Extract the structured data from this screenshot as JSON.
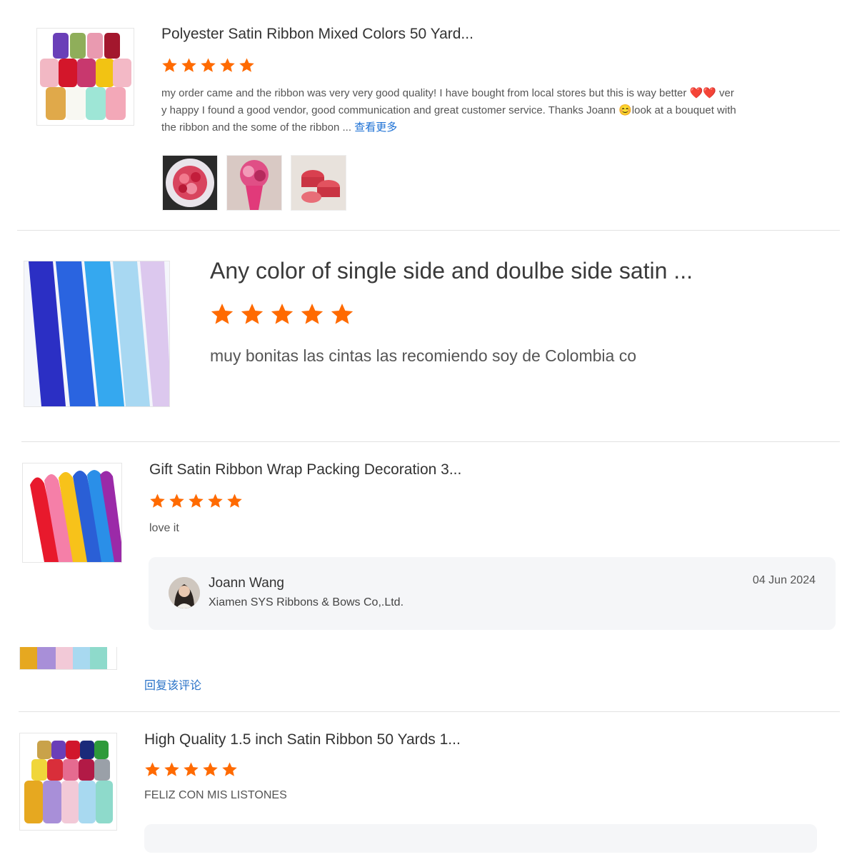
{
  "colors": {
    "star": "#ff6a00",
    "link": "#1a6fd4",
    "separator": "#e2e2e2",
    "reply_bg": "#f5f6f8"
  },
  "reviews": [
    {
      "title": "Polyester Satin Ribbon Mixed Colors 50 Yard...",
      "rating": 5,
      "text_line1": "my order came and the ribbon was very very good quality! I have bought from local stores but this is way better ❤️❤️ ver",
      "text_line2": "y happy I found a good vendor, good communication and great customer service. Thanks Joann 😊look at a bouquet with",
      "text_line3": "the ribbon and the some of the ribbon ...",
      "more_label": "查看更多",
      "photos": [
        "bouquet-photo-1",
        "bouquet-photo-2",
        "ribbon-rolls-photo"
      ]
    },
    {
      "title": "Any color of single side and doulbe side satin ...",
      "rating": 5,
      "text": "muy bonitas las cintas las recomiendo soy de Colombia co"
    },
    {
      "title": "Gift Satin Ribbon Wrap Packing Decoration 3...",
      "rating": 5,
      "text": "love it",
      "seller_reply": {
        "name": "Joann Wang",
        "company": "Xiamen SYS Ribbons & Bows Co,.Ltd.",
        "date": "04 Jun 2024"
      },
      "reply_link": "回复该评论"
    },
    {
      "title": "High Quality 1.5 inch Satin Ribbon 50 Yards 1...",
      "rating": 5,
      "text": "FELIZ CON MIS LISTONES"
    }
  ]
}
